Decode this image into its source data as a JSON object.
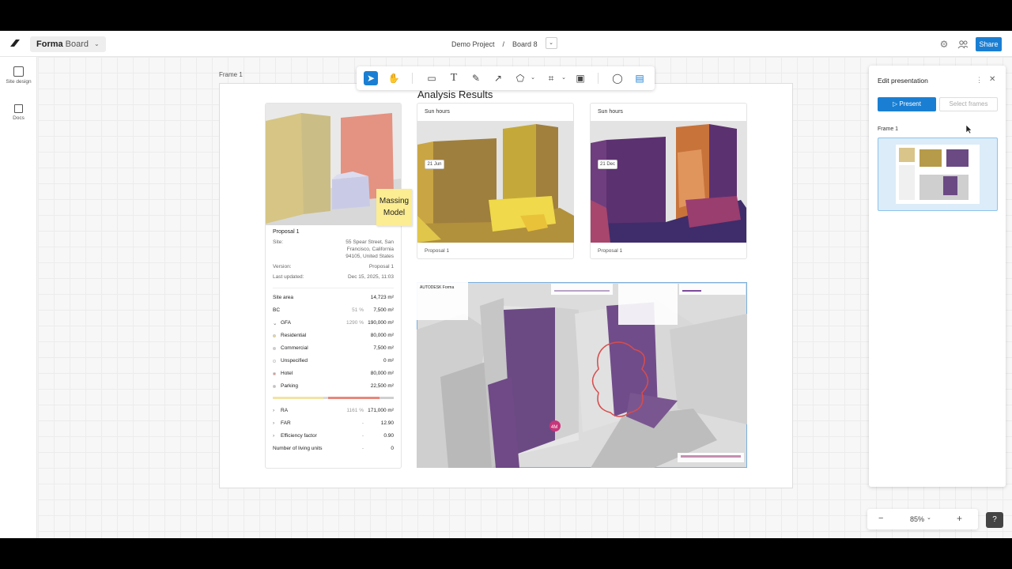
{
  "app": {
    "name_bold": "Forma",
    "name_rest": "Board"
  },
  "breadcrumb": {
    "project": "Demo Project",
    "separator": "/",
    "board": "Board 8"
  },
  "header": {
    "share_label": "Share"
  },
  "rail": [
    {
      "label": "Site design"
    },
    {
      "label": "Docs"
    }
  ],
  "canvas": {
    "frame_label": "Frame 1",
    "analysis_title": "Analysis Results",
    "sticky_note": [
      "Massing",
      "Model"
    ]
  },
  "proposal_card": {
    "title": "Proposal 1",
    "site_label": "Site:",
    "site_value": [
      "55 Spear Street, San",
      "Francisco, California",
      "94105, United States"
    ],
    "version_label": "Version:",
    "version_value": "Proposal 1",
    "updated_label": "Last updated:",
    "updated_value": "Dec 15, 2025, 11:03",
    "rows": [
      {
        "label": "Site area",
        "pct": "",
        "value": "14,723 m²"
      },
      {
        "label": "BC",
        "pct": "51 %",
        "value": "7,500 m²"
      },
      {
        "label": "GFA",
        "pct": "1290 %",
        "value": "190,000 m²"
      },
      {
        "label": "Residential",
        "pct": "",
        "value": "80,000 m²"
      },
      {
        "label": "Commercial",
        "pct": "",
        "value": "7,500 m²"
      },
      {
        "label": "Unspecified",
        "pct": "",
        "value": "0 m²"
      },
      {
        "label": "Hotel",
        "pct": "",
        "value": "80,000 m²"
      },
      {
        "label": "Parking",
        "pct": "",
        "value": "22,500 m²"
      },
      {
        "label": "RA",
        "pct": "1161 %",
        "value": "171,000 m²"
      },
      {
        "label": "FAR",
        "pct": "-",
        "value": "12.90"
      },
      {
        "label": "Efficiency factor",
        "pct": "-",
        "value": "0.90"
      },
      {
        "label": "Number of living units",
        "pct": "-",
        "value": "0"
      }
    ]
  },
  "sun_cards": [
    {
      "title": "Sun hours",
      "date": "21 Jun",
      "footer": "Proposal 1"
    },
    {
      "title": "Sun hours",
      "date": "21 Dec",
      "footer": "Proposal 1"
    }
  ],
  "map_view": {
    "brand": "AUTODESK Forma",
    "badge": "4M"
  },
  "panel": {
    "title": "Edit presentation",
    "present_label": "Present",
    "select_label": "Select frames",
    "frame_label": "Frame 1"
  },
  "zoom": {
    "minus": "−",
    "level": "85%",
    "plus": "+"
  },
  "colors": {
    "accent": "#1a7fd3",
    "sticky": "#fcec92",
    "residential": "#f2d779",
    "hotel": "#e8877b"
  }
}
